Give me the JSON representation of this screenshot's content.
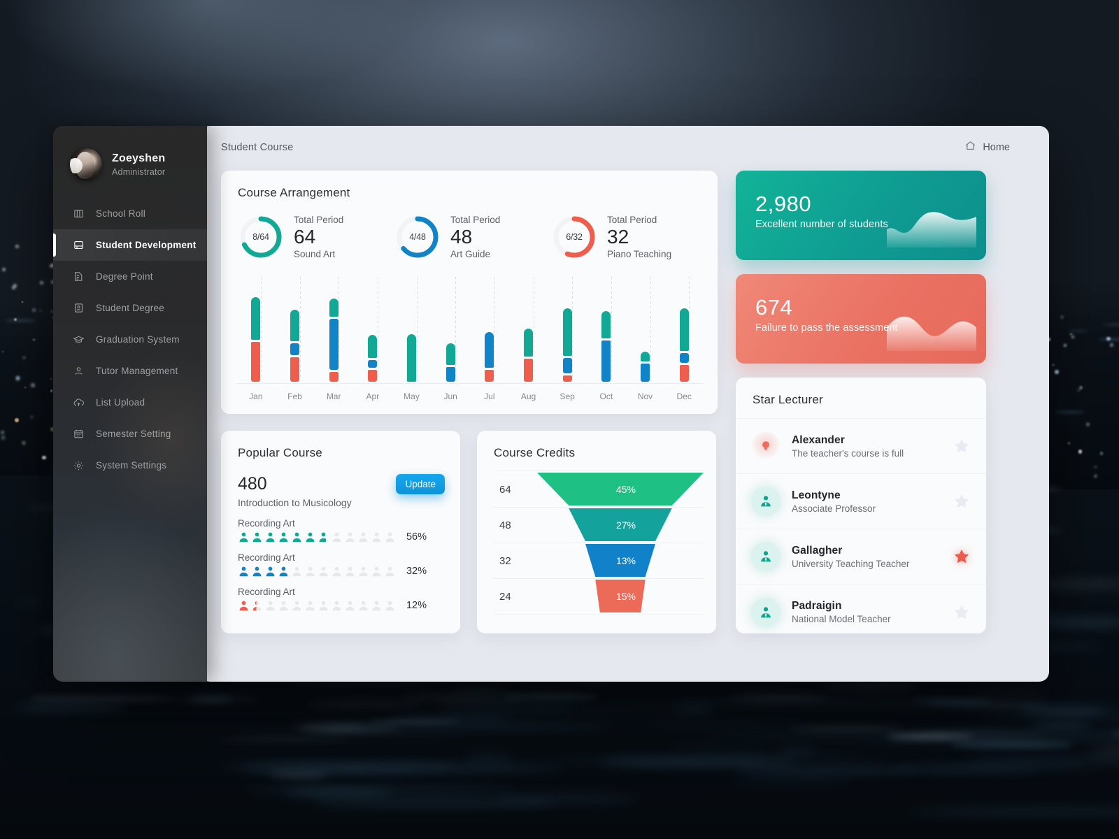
{
  "sidebar": {
    "profile": {
      "name": "Zoeyshen",
      "role": "Administrator",
      "avatar_icon": "user-avatar"
    },
    "items": [
      {
        "label": "School Roll",
        "icon": "columns-icon",
        "active": false
      },
      {
        "label": "Student Development",
        "icon": "book-icon",
        "active": true
      },
      {
        "label": "Degree Point",
        "icon": "document-icon",
        "active": false
      },
      {
        "label": "Student Degree",
        "icon": "id-card-icon",
        "active": false
      },
      {
        "label": "Graduation System",
        "icon": "graduation-cap-icon",
        "active": false
      },
      {
        "label": "Tutor Management",
        "icon": "user-icon",
        "active": false
      },
      {
        "label": "List Upload",
        "icon": "cloud-upload-icon",
        "active": false
      },
      {
        "label": "Semester Setting",
        "icon": "calendar-icon",
        "active": false
      },
      {
        "label": "System Settings",
        "icon": "gear-icon",
        "active": false
      }
    ]
  },
  "topbar": {
    "breadcrumb": "Student Course",
    "home_label": "Home",
    "home_icon": "home-icon"
  },
  "course_arrangement": {
    "title": "Course Arrangement",
    "donuts": [
      {
        "ratio": "8/64",
        "total_period_label": "Total Period",
        "value": "64",
        "name": "Sound Art",
        "color": "#12a896",
        "pct": 68
      },
      {
        "ratio": "4/48",
        "total_period_label": "Total Period",
        "value": "48",
        "name": "Art Guide",
        "color": "#1184c8",
        "pct": 64
      },
      {
        "ratio": "6/32",
        "total_period_label": "Total Period",
        "value": "32",
        "name": "Piano Teaching",
        "color": "#ef5e4c",
        "pct": 56
      }
    ]
  },
  "popular_course": {
    "title": "Popular Course",
    "count": "480",
    "course_name": "Introduction to Musicology",
    "update_label": "Update",
    "rows": [
      {
        "label": "Recording Art",
        "value": "56%",
        "pct": 56,
        "color": "#12a896"
      },
      {
        "label": "Recording Art",
        "value": "32%",
        "pct": 32,
        "color": "#1184c8"
      },
      {
        "label": "Recording Art",
        "value": "12%",
        "pct": 12,
        "color": "#ef5e4c"
      }
    ]
  },
  "course_credits": {
    "title": "Course Credits"
  },
  "stats": [
    {
      "value": "2,980",
      "label": "Excellent number of students",
      "color": "#0f9c92"
    },
    {
      "value": "674",
      "label": "Failure to pass the assessment",
      "color": "#ea7263"
    }
  ],
  "star_lecturer": {
    "title": "Star Lecturer",
    "items": [
      {
        "name": "Alexander",
        "desc": "The teacher's course is full",
        "icon": "lightbulb-icon",
        "icon_style": "red",
        "starred": false
      },
      {
        "name": "Leontyne",
        "desc": "Associate Professor",
        "icon": "person-icon",
        "icon_style": "teal",
        "starred": false
      },
      {
        "name": "Gallagher",
        "desc": "University Teaching Teacher",
        "icon": "person-icon",
        "icon_style": "teal",
        "starred": true
      },
      {
        "name": "Padraigin",
        "desc": "National Model Teacher",
        "icon": "person-icon",
        "icon_style": "teal",
        "starred": false
      }
    ]
  },
  "chart_data": [
    {
      "type": "bar",
      "subtype": "stacked-column",
      "title": "Course Arrangement",
      "categories": [
        "Jan",
        "Feb",
        "Mar",
        "Apr",
        "May",
        "Jun",
        "Jul",
        "Aug",
        "Sep",
        "Oct",
        "Nov",
        "Dec"
      ],
      "series": [
        {
          "name": "Green",
          "color": "#12a896",
          "values": [
            52,
            38,
            22,
            28,
            58,
            26,
            0,
            34,
            58,
            33,
            12,
            52
          ]
        },
        {
          "name": "Blue",
          "color": "#1184c8",
          "values": [
            0,
            14,
            62,
            10,
            0,
            18,
            44,
            0,
            18,
            50,
            22,
            12
          ]
        },
        {
          "name": "Red",
          "color": "#ef5e4c",
          "values": [
            48,
            30,
            12,
            14,
            0,
            0,
            14,
            28,
            8,
            0,
            0,
            20
          ]
        }
      ],
      "grid": true,
      "legend": "none",
      "xlabel": "",
      "ylabel": ""
    },
    {
      "type": "funnel",
      "title": "Course Credits",
      "categories": [
        "64",
        "48",
        "32",
        "24"
      ],
      "values": [
        45,
        27,
        13,
        15
      ],
      "value_labels": [
        "45%",
        "27%",
        "13%",
        "15%"
      ],
      "colors": [
        "#1ec084",
        "#14a39c",
        "#1182ca",
        "#ec6a58"
      ],
      "legend": "none"
    },
    {
      "type": "donut",
      "title": "Total Period donuts",
      "categories": [
        "Sound Art",
        "Art Guide",
        "Piano Teaching"
      ],
      "values": [
        68,
        64,
        56
      ],
      "labels": [
        "8/64",
        "4/48",
        "6/32"
      ],
      "totals": [
        64,
        48,
        32
      ],
      "colors": [
        "#12a896",
        "#1184c8",
        "#ef5e4c"
      ]
    },
    {
      "type": "bar",
      "subtype": "pictogram",
      "title": "Popular Course",
      "categories": [
        "Recording Art",
        "Recording Art",
        "Recording Art"
      ],
      "values": [
        56,
        32,
        12
      ],
      "value_labels": [
        "56%",
        "32%",
        "12%"
      ],
      "colors": [
        "#12a896",
        "#1184c8",
        "#ef5e4c"
      ],
      "icons_per_row": 12
    }
  ]
}
